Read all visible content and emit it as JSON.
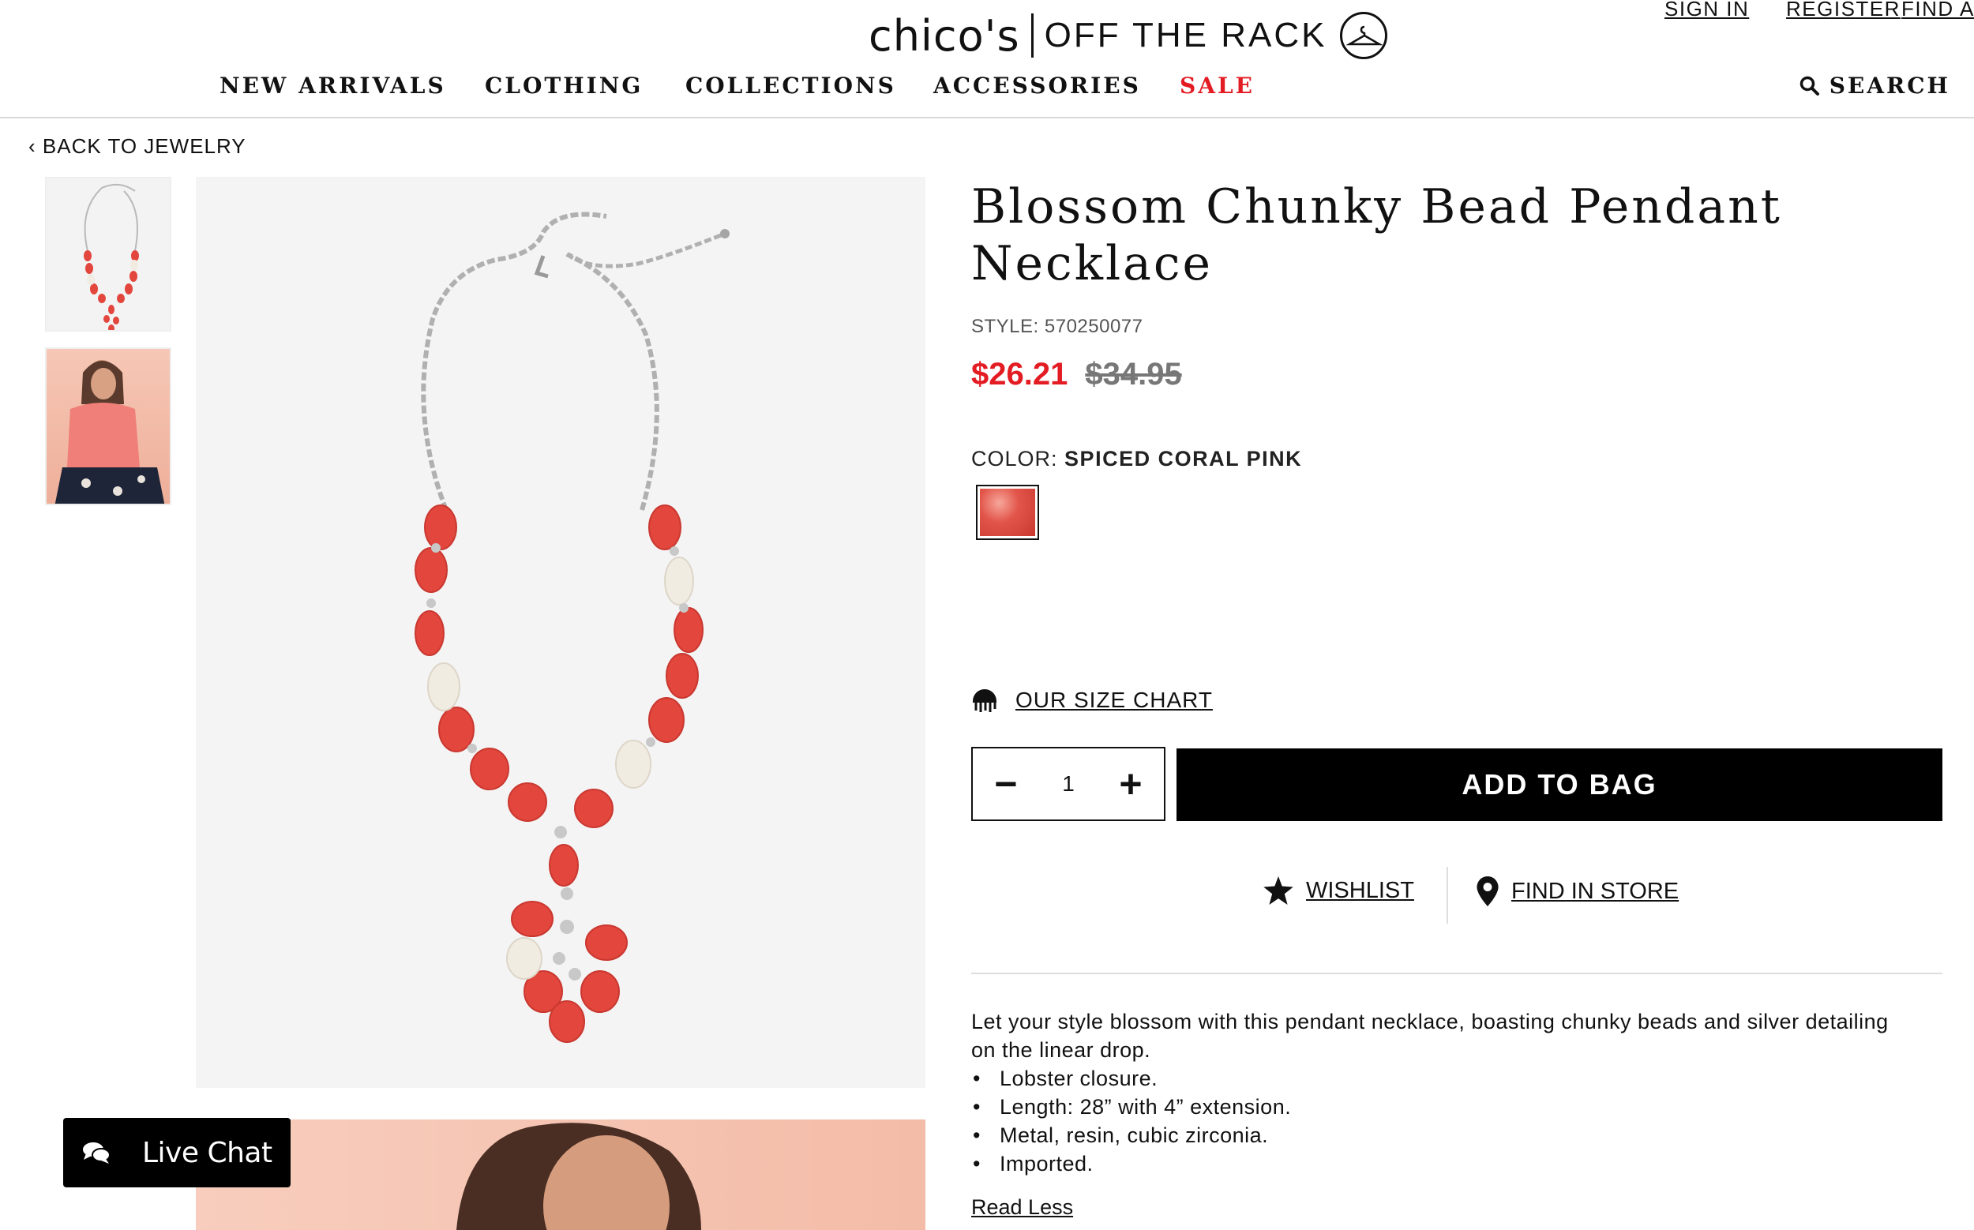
{
  "header": {
    "util_links": [
      "SIGN IN",
      "REGISTER",
      "FIND A S"
    ],
    "logo_brand": "chico's",
    "logo_sub": "OFF THE RACK"
  },
  "nav": {
    "items": [
      "NEW ARRIVALS",
      "CLOTHING",
      "COLLECTIONS",
      "ACCESSORIES",
      "SALE"
    ],
    "search_label": "SEARCH"
  },
  "breadcrumb": {
    "back_label": "BACK TO JEWELRY"
  },
  "product": {
    "title": "Blossom Chunky Bead Pendant Necklace",
    "style": "STYLE: 570250077",
    "sale_price": "$26.21",
    "original_price": "$34.95",
    "color_label": "COLOR:",
    "color_value": "SPICED CORAL PINK",
    "size_chart_label": "OUR SIZE CHART",
    "quantity": "1",
    "add_to_bag": "ADD TO BAG",
    "wishlist": "WISHLIST",
    "find_in_store": "FIND IN STORE",
    "description": "Let your style blossom with this pendant necklace, boasting chunky beads and silver detailing on the linear drop.",
    "bullets": [
      "Lobster closure.",
      "Length: 28” with 4” extension.",
      "Metal, resin, cubic zirconia.",
      "Imported."
    ],
    "read_less": "Read Less"
  },
  "chat": {
    "label": "Live Chat"
  },
  "colors": {
    "sale_red": "#e31b23",
    "bead_red": "#e2463d",
    "bead_white": "#f1ece2"
  }
}
